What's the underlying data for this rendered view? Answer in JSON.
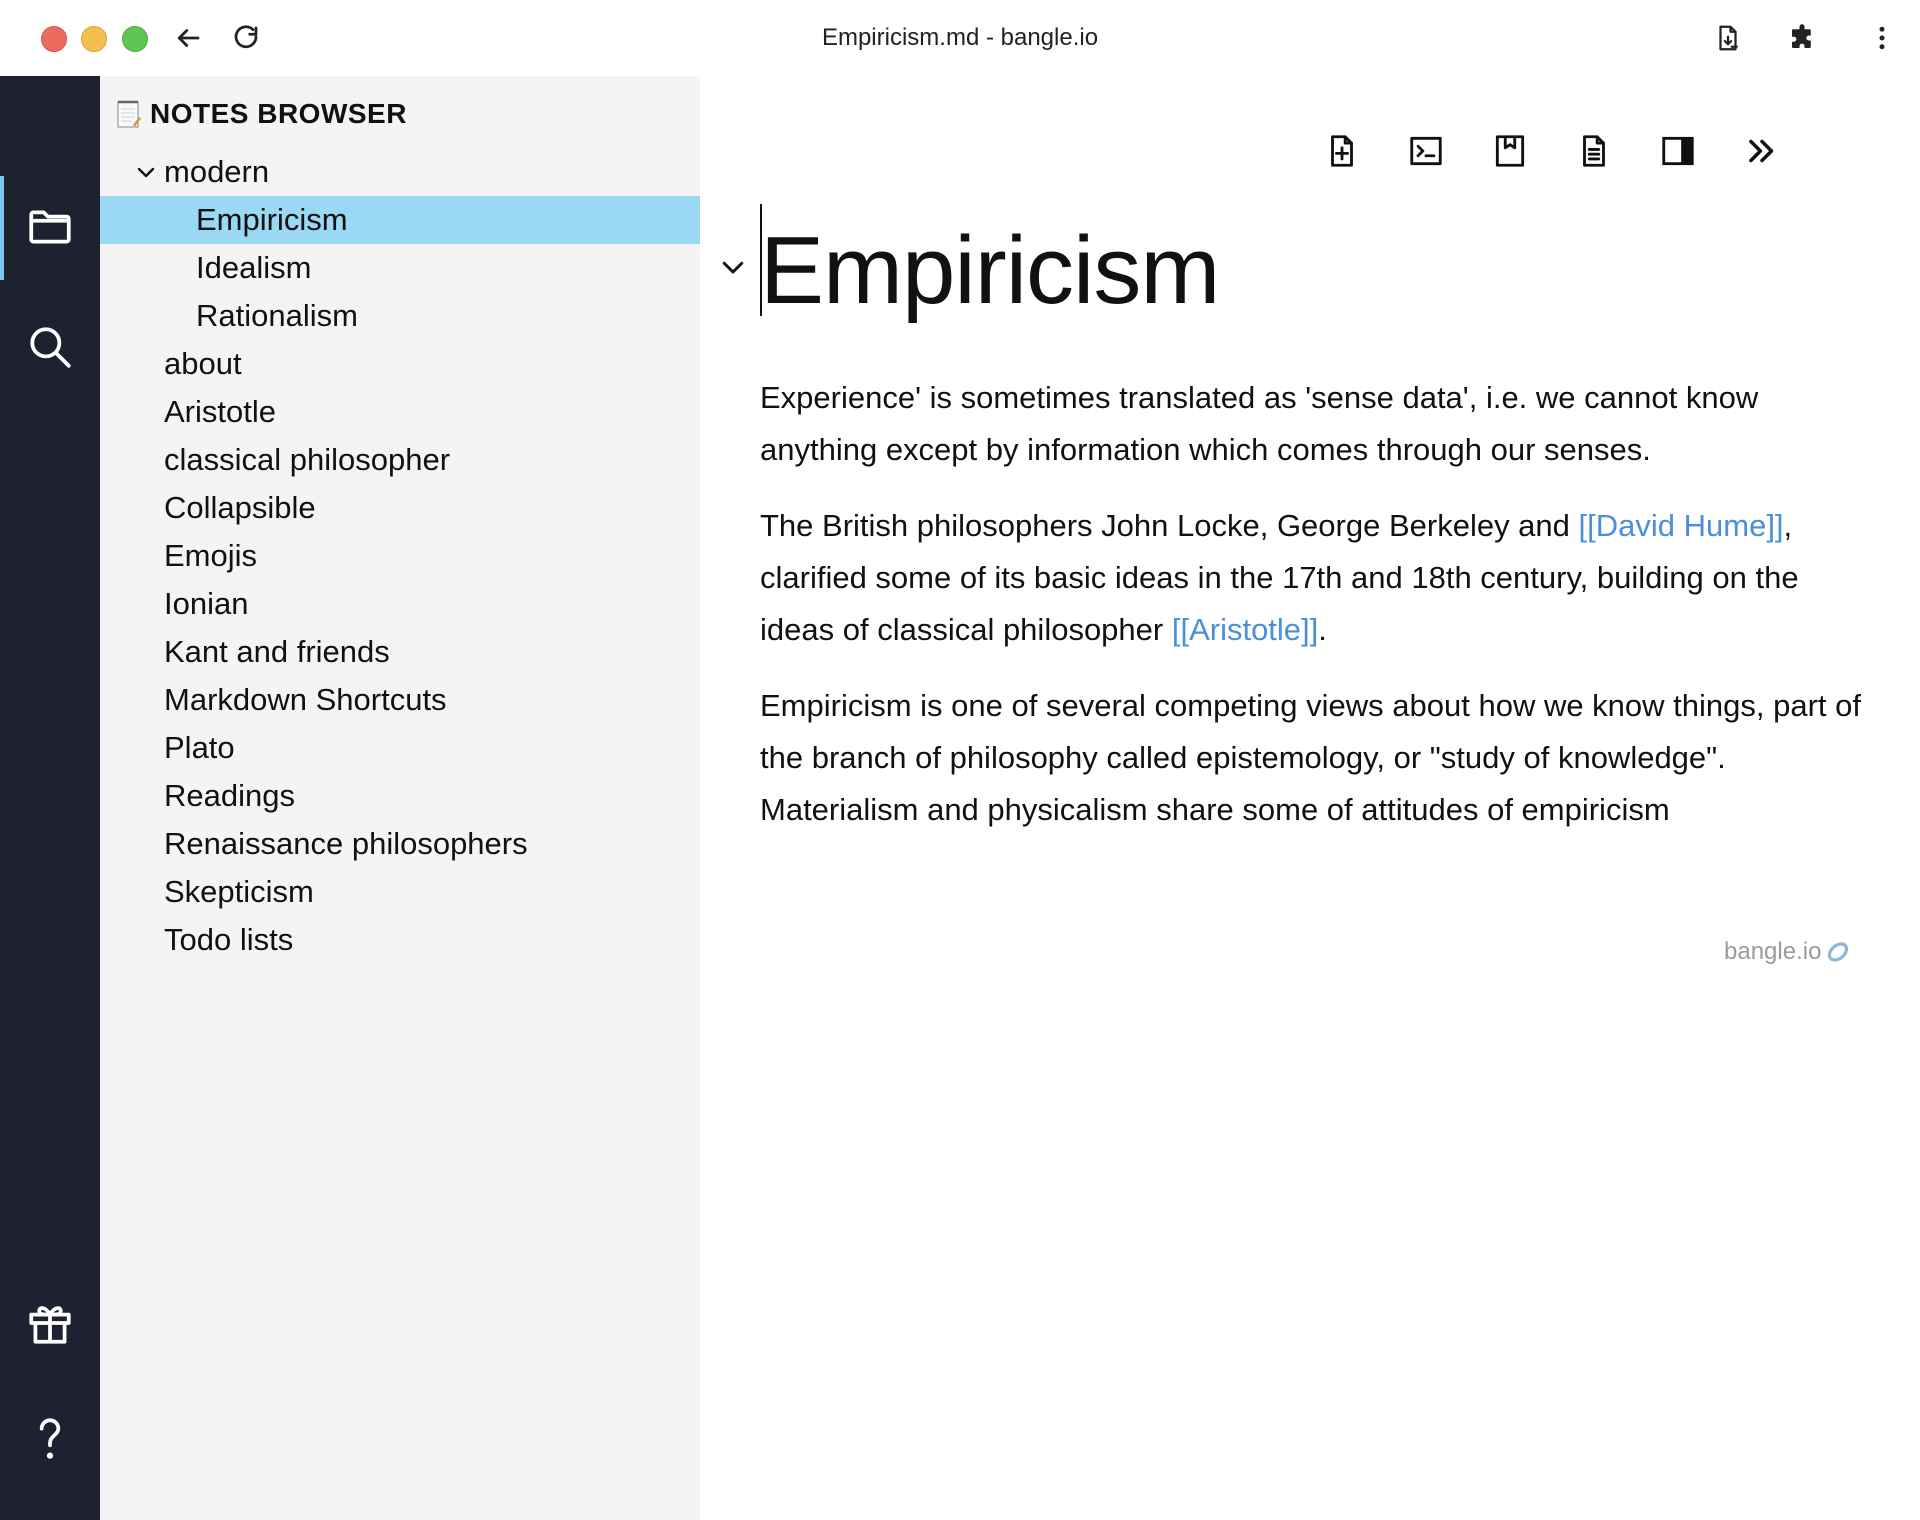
{
  "window": {
    "title": "Empiricism.md - bangle.io"
  },
  "browser_toolbar": {
    "icons": [
      "back-arrow-icon",
      "reload-icon",
      "install-app-icon",
      "extensions-icon",
      "more-menu-icon"
    ]
  },
  "activity_bar": {
    "items": [
      {
        "name": "files",
        "icon": "folder-icon",
        "active": true
      },
      {
        "name": "search",
        "icon": "search-icon",
        "active": false
      },
      {
        "name": "whats-new",
        "icon": "gift-icon",
        "active": false
      },
      {
        "name": "help",
        "icon": "question-mark-icon",
        "active": false
      }
    ],
    "accent_color": "#7cc8f0",
    "background_color": "#1e2130"
  },
  "sidebar": {
    "title": "NOTES BROWSER",
    "tree": [
      {
        "label": "modern",
        "expanded": true
      },
      {
        "label": "Empiricism",
        "active": true
      },
      {
        "label": "Idealism"
      },
      {
        "label": "Rationalism"
      },
      {
        "label": "about"
      },
      {
        "label": "Aristotle"
      },
      {
        "label": "classical philosopher"
      },
      {
        "label": "Collapsible"
      },
      {
        "label": "Emojis"
      },
      {
        "label": "Ionian"
      },
      {
        "label": "Kant and friends"
      },
      {
        "label": "Markdown Shortcuts"
      },
      {
        "label": "Plato"
      },
      {
        "label": "Readings"
      },
      {
        "label": "Renaissance philosophers"
      },
      {
        "label": "Skepticism"
      },
      {
        "label": "Todo lists"
      }
    ],
    "active_color": "#9bd8f4"
  },
  "editor": {
    "toolbar_icons": [
      "new-note-icon",
      "command-palette-icon",
      "bookmark-icon",
      "note-outline-icon",
      "split-screen-icon",
      "collapse-sidebar-icon"
    ],
    "title": "Empiricism",
    "p1": "Experience' is sometimes translated as 'sense data', i.e. we cannot know anything except by information which comes through our senses.",
    "p2_a": "The British philosophers John Locke, George Berkeley and ",
    "p2_link1": "[[David Hume]]",
    "p2_b": ", clarified some of its basic ideas in the 17th and 18th century, building on the ideas of classical philosopher ",
    "p2_link2": "[[Aristotle]]",
    "p2_c": ".",
    "p3": "Empiricism is one of several competing views about how we know things, part of the branch of philosophy called epistemology, or \"study of knowledge\". Materialism and physicalism share some of attitudes of empiricism",
    "brand": "bangle.io",
    "link_color": "#4a90d9"
  }
}
